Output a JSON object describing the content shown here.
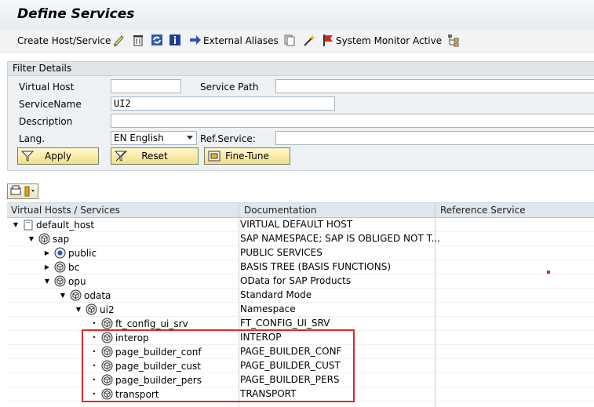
{
  "window": {
    "title": "Define Services"
  },
  "toolbar": {
    "create_label": "Create Host/Service",
    "external_aliases_label": "External Aliases",
    "system_monitor_label": "System Monitor Active",
    "icons": [
      "edit-icon",
      "delete-icon",
      "refresh-icon",
      "info-icon",
      "arrow-right-icon",
      "copy-icon",
      "magic-wand-icon",
      "flag-icon",
      "hierarchy-icon"
    ]
  },
  "filter": {
    "header": "Filter Details",
    "virtual_host_label": "Virtual Host",
    "virtual_host_value": "",
    "service_path_label": "Service Path",
    "service_path_value": "",
    "service_name_label": "ServiceName",
    "service_name_value": "UI2",
    "description_label": "Description",
    "description_value": "",
    "lang_label": "Lang.",
    "lang_value": "EN English",
    "ref_service_label": "Ref.Service:",
    "ref_service_value": "",
    "apply_label": "Apply",
    "reset_label": "Reset",
    "finetune_label": "Fine-Tune"
  },
  "tree": {
    "columns": [
      "Virtual Hosts / Services",
      "Documentation",
      "Reference Service"
    ],
    "rows": [
      {
        "label": "default_host",
        "doc": "VIRTUAL DEFAULT HOST",
        "level": 0,
        "expand": "open",
        "icon": "folder-icon"
      },
      {
        "label": "sap",
        "doc": "SAP NAMESPACE; SAP IS OBLIGED NOT T...",
        "level": 1,
        "expand": "open",
        "icon": "service-node-icon"
      },
      {
        "label": "public",
        "doc": "PUBLIC SERVICES",
        "level": 2,
        "expand": "closed",
        "icon": "service-public-icon"
      },
      {
        "label": "bc",
        "doc": "BASIS TREE (BASIS FUNCTIONS)",
        "level": 2,
        "expand": "closed",
        "icon": "service-node-icon"
      },
      {
        "label": "opu",
        "doc": "OData for SAP Products",
        "level": 2,
        "expand": "open",
        "icon": "service-node-icon"
      },
      {
        "label": "odata",
        "doc": "Standard Mode",
        "level": 3,
        "expand": "open",
        "icon": "service-node-icon"
      },
      {
        "label": "ui2",
        "doc": "Namespace",
        "level": 4,
        "expand": "open",
        "icon": "service-node-icon"
      },
      {
        "label": "ft_config_ui_srv",
        "doc": "FT_CONFIG_UI_SRV",
        "level": 5,
        "expand": "leaf",
        "icon": "service-node-icon"
      },
      {
        "label": "interop",
        "doc": "INTEROP",
        "level": 5,
        "expand": "leaf",
        "icon": "service-node-icon"
      },
      {
        "label": "page_builder_conf",
        "doc": "PAGE_BUILDER_CONF",
        "level": 5,
        "expand": "leaf",
        "icon": "service-node-icon"
      },
      {
        "label": "page_builder_cust",
        "doc": "PAGE_BUILDER_CUST",
        "level": 5,
        "expand": "leaf",
        "icon": "service-node-icon"
      },
      {
        "label": "page_builder_pers",
        "doc": "PAGE_BUILDER_PERS",
        "level": 5,
        "expand": "leaf",
        "icon": "service-node-icon"
      },
      {
        "label": "transport",
        "doc": "TRANSPORT",
        "level": 5,
        "expand": "leaf",
        "icon": "service-node-icon"
      }
    ]
  },
  "colors": {
    "highlight": "#e0242c",
    "button": "#f4de86",
    "header": "#dfe6ec"
  }
}
